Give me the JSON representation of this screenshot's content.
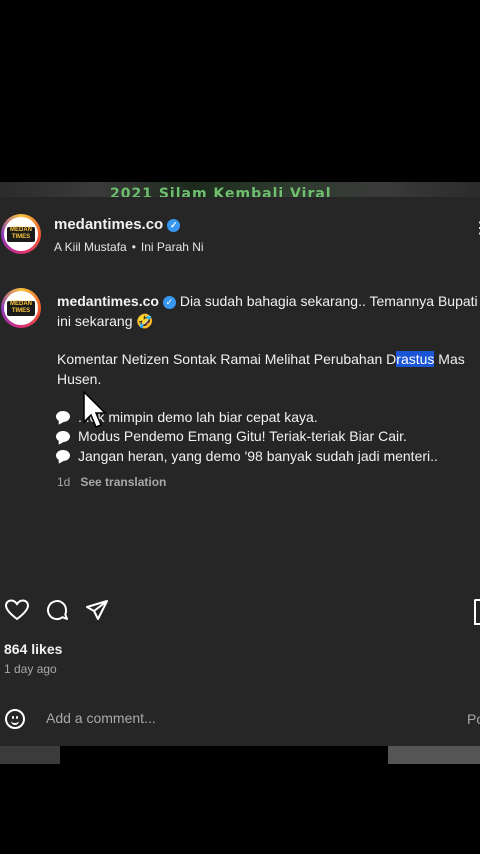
{
  "background": {
    "top_strip_text": "2021 Silam Kembali Viral"
  },
  "post": {
    "username": "medantimes.co",
    "verified": true,
    "audio_artist": "A Kiil Mustafa",
    "audio_title": "Ini Parah Ni",
    "more_icon": "more-dots-icon",
    "avatar_text": "MEDAN TIMES"
  },
  "caption": {
    "username": "medantimes.co",
    "line1": "Dia sudah bahagia sekarang.. Temannya Bupati ini sekarang 🤣",
    "para2_before": "Komentar Netizen Sontak Ramai Melihat Perubahan D",
    "para2_highlight": "rastus",
    "para2_after": " Mas Husen.",
    "comments": [
      "...ek mimpin demo lah biar cepat kaya.",
      "Modus Pendemo Emang Gitu! Teriak-teriak Biar Cair.",
      "Jangan heran, yang demo '98 banyak sudah jadi menteri.."
    ],
    "time": "1d",
    "see_translation": "See translation"
  },
  "actions": {
    "like_icon": "heart-icon",
    "comment_icon": "comment-icon",
    "share_icon": "share-icon",
    "save_icon": "bookmark-icon"
  },
  "stats": {
    "likes": "864 likes",
    "posted": "1 day ago"
  },
  "comment_bar": {
    "placeholder": "Add a comment...",
    "post_label": "Post",
    "emoji_icon": "emoji-icon"
  },
  "colors": {
    "panel": "#262626",
    "verified": "#3897f0",
    "highlight": "#1a55d6",
    "muted": "#a8a8a8"
  }
}
